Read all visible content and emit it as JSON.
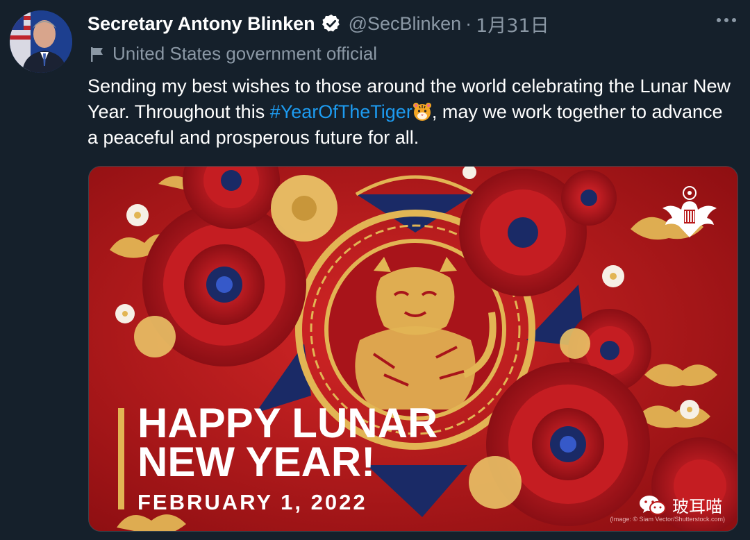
{
  "author": {
    "name": "Secretary Antony Blinken",
    "handle": "@SecBlinken",
    "separator": "·",
    "date": "1月31日",
    "label": "United States government official"
  },
  "tweet": {
    "text_before": "Sending my best wishes to those around the world celebrating the Lunar New Year. Throughout this ",
    "hashtag": "#YearOfTheTiger",
    "text_after": ", may we work together to advance a peaceful and prosperous future for all."
  },
  "image": {
    "headline_line1": "HAPPY LUNAR",
    "headline_line2": "NEW YEAR!",
    "date_line": "FEBRUARY 1, 2022",
    "credit": "(Image: © Siam Vector/Shutterstock.com)",
    "watermark": "玻耳喵"
  },
  "colors": {
    "background": "#15202b",
    "hashtag": "#1d9bf0",
    "muted": "#8b98a5",
    "card_red": "#b81a1a",
    "gold": "#e2b554",
    "navy": "#1a2a66"
  },
  "icons": {
    "verified": "verified-badge-icon",
    "label": "government-flag-icon",
    "more": "more-options-icon",
    "emoji": "tiger-face-emoji-icon",
    "seal": "us-state-department-seal-icon",
    "watermark": "wechat-icon"
  }
}
